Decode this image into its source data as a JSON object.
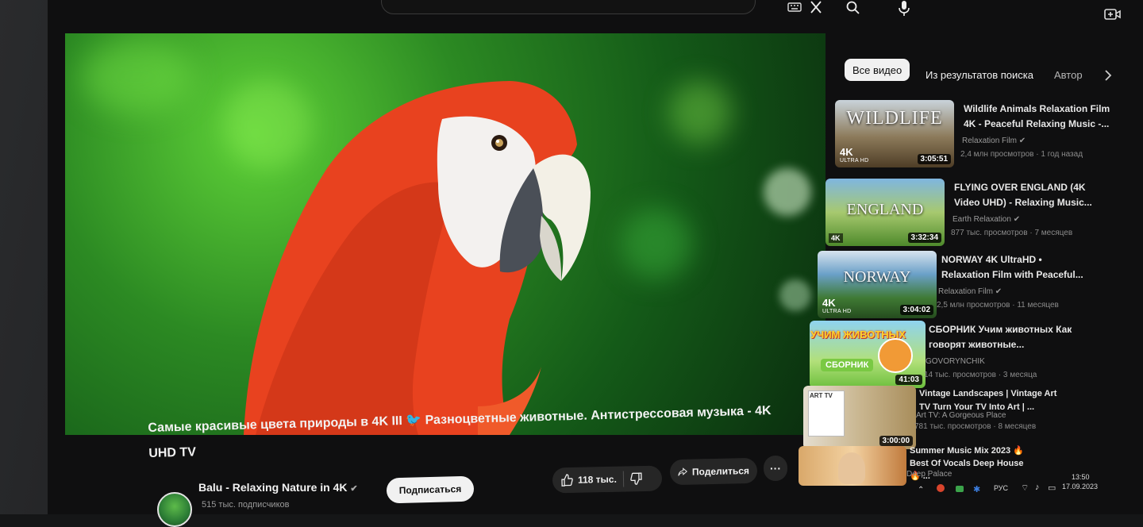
{
  "player": {
    "title": "Самые красивые цвета природы в 4K III 🐦 Разноцветные животные. Антистрессовая музыка - 4K UHD TV"
  },
  "channel": {
    "name": "Balu - Relaxing Nature in 4K",
    "subscribers": "515 тыс. подписчиков",
    "subscribe_label": "Подписаться"
  },
  "actions": {
    "likes": "118 тыс.",
    "share_label": "Поделиться",
    "more": "···"
  },
  "chips": [
    "Все видео",
    "Из результатов поиска",
    "Автор"
  ],
  "recommendations": [
    {
      "thumb_text": "WILDLIFE",
      "duration": "3:05:51",
      "badge": "4K",
      "badge_sub": "ULTRA HD",
      "title": "Wildlife Animals Relaxation Film 4K - Peaceful Relaxing Music -...",
      "channel": "Relaxation Film",
      "meta": "2,4 млн просмотров · 1 год назад"
    },
    {
      "thumb_text": "ENGLAND",
      "duration": "3:32:34",
      "badge": "4K",
      "badge_sub": "",
      "title": "FLYING OVER ENGLAND (4K Video UHD) - Relaxing Music...",
      "channel": "Earth Relaxation",
      "meta": "877 тыс. просмотров · 7 месяцев"
    },
    {
      "thumb_text": "NORWAY",
      "duration": "3:04:02",
      "badge": "4K",
      "badge_sub": "ULTRA HD",
      "title": "NORWAY 4K UltraHD • Relaxation Film with Peaceful...",
      "channel": "Relaxation Film",
      "meta": "2,5 млн просмотров · 11 месяцев"
    },
    {
      "thumb_text": "УЧИМ ЖИВОТНЫХ",
      "thumb_sub": "СБОРНИК",
      "duration": "41:03",
      "badge": "",
      "badge_sub": "",
      "title": "СБОРНИК Учим животных Как говорят животные...",
      "channel": "GOVORYNCHIK",
      "meta": "14 тыс. просмотров · 3 месяца"
    },
    {
      "thumb_text": "ART TV",
      "duration": "3:00:00",
      "badge": "",
      "badge_sub": "",
      "title": "Vintage Landscapes | Vintage Art TV Turn Your TV Into Art | ...",
      "channel": "Art TV: A Gorgeous Place",
      "meta": "781 тыс. просмотров · 8 месяцев"
    },
    {
      "thumb_text": "",
      "duration": "",
      "badge": "",
      "badge_sub": "",
      "title": "Summer Music Mix 2023 🔥 Best Of Vocals Deep House 🔥 ...",
      "channel": "Deep Palace",
      "meta": ""
    }
  ],
  "taskbar": {
    "lang": "РУС",
    "time": "13:50",
    "date": "17.09.2023"
  },
  "colors": {
    "parrot_red": "#e8421f",
    "leaf_green": "#3aa52a",
    "bg": "#0f0f0f"
  }
}
